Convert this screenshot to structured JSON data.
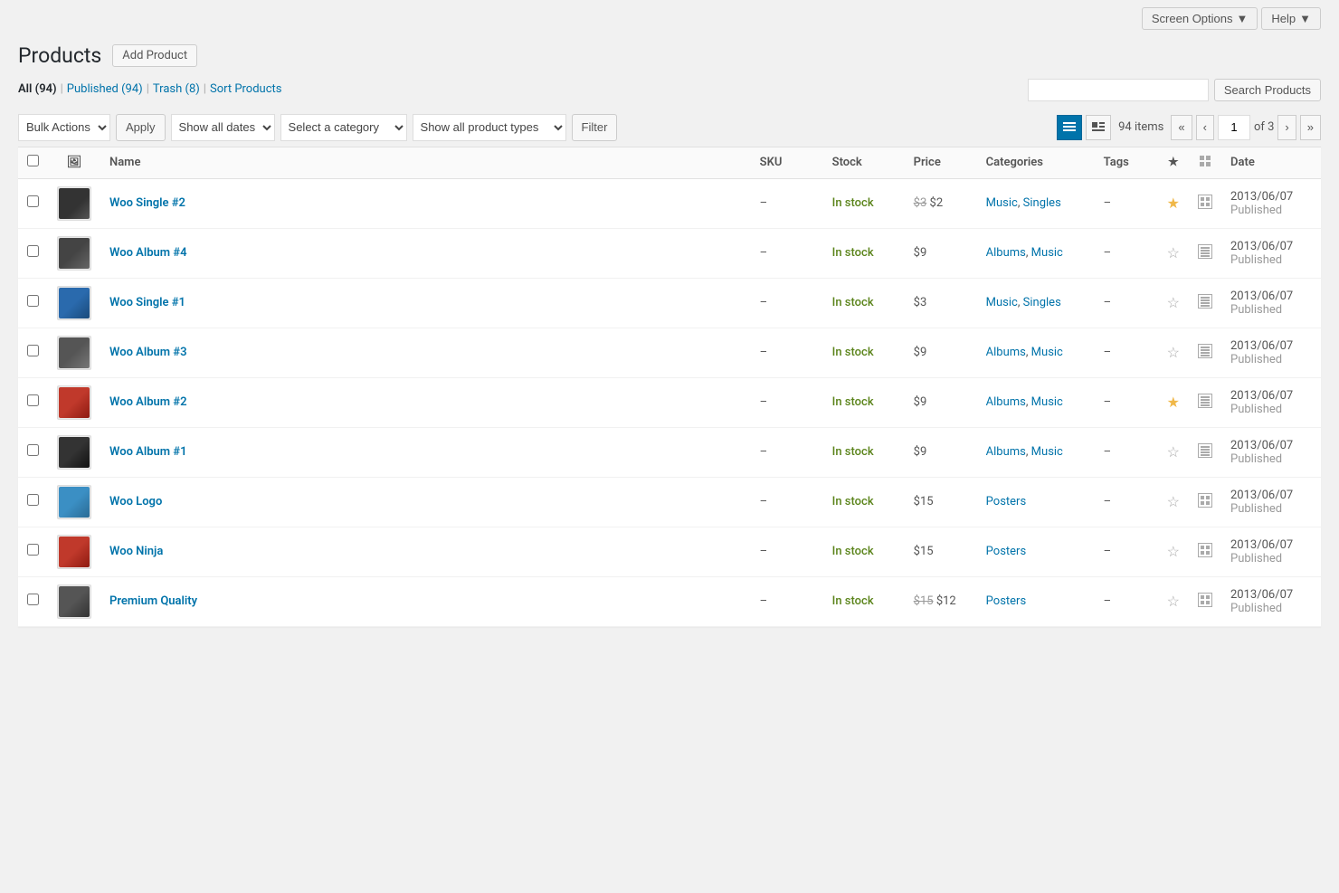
{
  "page": {
    "title": "Products",
    "add_product_label": "Add Product"
  },
  "screen_options": {
    "label": "Screen Options",
    "arrow": "▼"
  },
  "help": {
    "label": "Help",
    "arrow": "▼"
  },
  "subnav": {
    "items": [
      {
        "label": "All",
        "count": "(94)",
        "current": true
      },
      {
        "label": "Published",
        "count": "(94)",
        "current": false
      },
      {
        "label": "Trash",
        "count": "(8)",
        "current": false
      },
      {
        "label": "Sort Products",
        "count": "",
        "current": false
      }
    ]
  },
  "search": {
    "placeholder": "",
    "button_label": "Search Products"
  },
  "toolbar": {
    "bulk_actions_label": "Bulk Actions",
    "apply_label": "Apply",
    "show_all_dates_label": "Show all dates",
    "select_category_label": "Select a category",
    "show_all_types_label": "Show all product types",
    "filter_label": "Filter",
    "items_count": "94 items",
    "page_current": "1",
    "page_of": "of 3"
  },
  "table": {
    "columns": {
      "name": "Name",
      "sku": "SKU",
      "stock": "Stock",
      "price": "Price",
      "categories": "Categories",
      "tags": "Tags",
      "date": "Date"
    },
    "rows": [
      {
        "id": 1,
        "name": "Woo Single #2",
        "sku": "–",
        "stock": "In stock",
        "price_display": "$3 $2",
        "price_regular": "$3",
        "price_sale": "$2",
        "has_sale": true,
        "categories": "Music, Singles",
        "tags": "–",
        "featured": true,
        "date": "2013/06/07",
        "status": "Published",
        "thumb_class": "thumb-single2",
        "type_icon": "grid"
      },
      {
        "id": 2,
        "name": "Woo Album #4",
        "sku": "–",
        "stock": "In stock",
        "price_display": "$9",
        "price_regular": "$9",
        "price_sale": "",
        "has_sale": false,
        "categories": "Albums, Music",
        "tags": "–",
        "featured": false,
        "date": "2013/06/07",
        "status": "Published",
        "thumb_class": "thumb-album4",
        "type_icon": "download"
      },
      {
        "id": 3,
        "name": "Woo Single #1",
        "sku": "–",
        "stock": "In stock",
        "price_display": "$3",
        "price_regular": "$3",
        "price_sale": "",
        "has_sale": false,
        "categories": "Music, Singles",
        "tags": "–",
        "featured": false,
        "date": "2013/06/07",
        "status": "Published",
        "thumb_class": "thumb-single1",
        "type_icon": "download"
      },
      {
        "id": 4,
        "name": "Woo Album #3",
        "sku": "–",
        "stock": "In stock",
        "price_display": "$9",
        "price_regular": "$9",
        "price_sale": "",
        "has_sale": false,
        "categories": "Albums, Music",
        "tags": "–",
        "featured": false,
        "date": "2013/06/07",
        "status": "Published",
        "thumb_class": "thumb-album3",
        "type_icon": "download"
      },
      {
        "id": 5,
        "name": "Woo Album #2",
        "sku": "–",
        "stock": "In stock",
        "price_display": "$9",
        "price_regular": "$9",
        "price_sale": "",
        "has_sale": false,
        "categories": "Albums, Music",
        "tags": "–",
        "featured": true,
        "date": "2013/06/07",
        "status": "Published",
        "thumb_class": "thumb-album2",
        "type_icon": "download"
      },
      {
        "id": 6,
        "name": "Woo Album #1",
        "sku": "–",
        "stock": "In stock",
        "price_display": "$9",
        "price_regular": "$9",
        "price_sale": "",
        "has_sale": false,
        "categories": "Albums, Music",
        "tags": "–",
        "featured": false,
        "date": "2013/06/07",
        "status": "Published",
        "thumb_class": "thumb-album1",
        "type_icon": "download"
      },
      {
        "id": 7,
        "name": "Woo Logo",
        "sku": "–",
        "stock": "In stock",
        "price_display": "$15",
        "price_regular": "$15",
        "price_sale": "",
        "has_sale": false,
        "categories": "Posters",
        "tags": "–",
        "featured": false,
        "date": "2013/06/07",
        "status": "Published",
        "thumb_class": "thumb-logo",
        "type_icon": "grid"
      },
      {
        "id": 8,
        "name": "Woo Ninja",
        "sku": "–",
        "stock": "In stock",
        "price_display": "$15",
        "price_regular": "$15",
        "price_sale": "",
        "has_sale": false,
        "categories": "Posters",
        "tags": "–",
        "featured": false,
        "date": "2013/06/07",
        "status": "Published",
        "thumb_class": "thumb-ninja",
        "type_icon": "grid"
      },
      {
        "id": 9,
        "name": "Premium Quality",
        "sku": "–",
        "stock": "In stock",
        "price_display": "$15 $12",
        "price_regular": "$15",
        "price_sale": "$12",
        "has_sale": true,
        "categories": "Posters",
        "tags": "–",
        "featured": false,
        "date": "2013/06/07",
        "status": "Published",
        "thumb_class": "thumb-premium",
        "type_icon": "grid"
      }
    ]
  },
  "colors": {
    "accent": "#0073aa",
    "in_stock": "#5b841b",
    "star_filled": "#f0b849"
  }
}
